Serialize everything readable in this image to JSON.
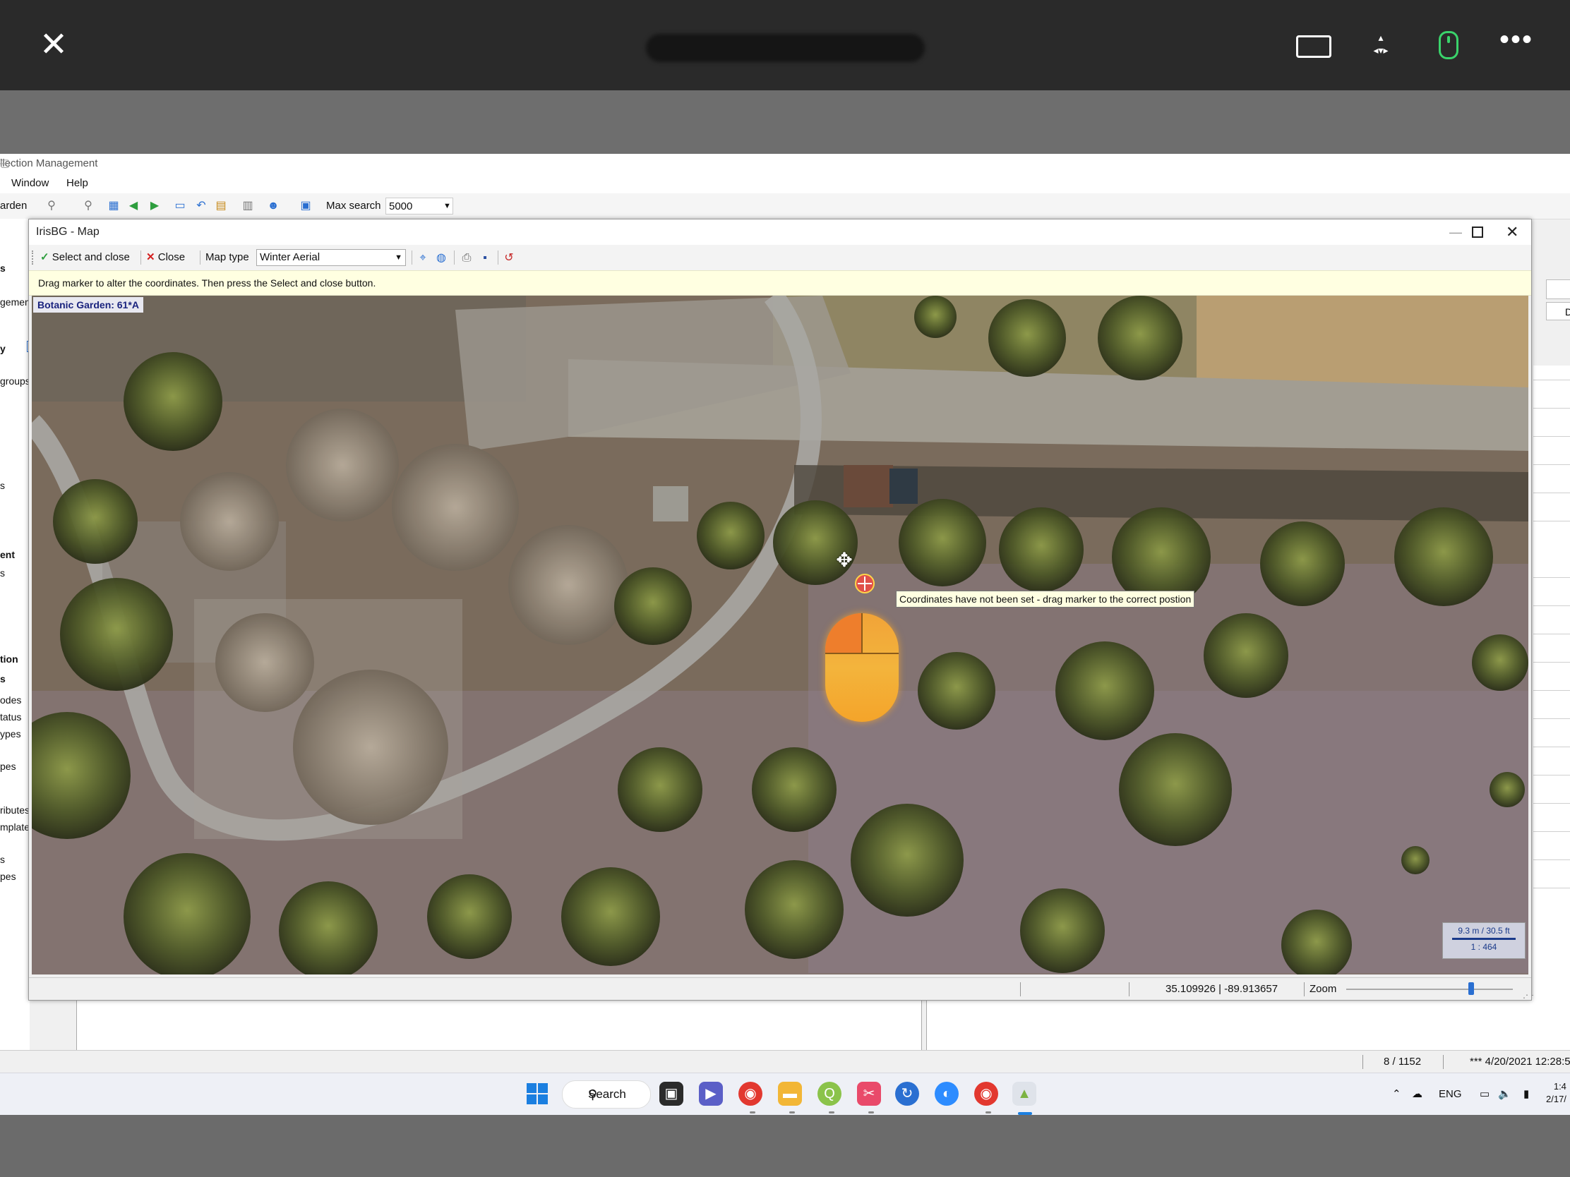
{
  "remote_bar": {
    "close_icon": "close-icon",
    "keyboard_icon": "keyboard-icon",
    "arrows_icon": "arrow-keys-icon",
    "mouse_icon": "mouse-icon",
    "more_glyph": "•••"
  },
  "app": {
    "title": "llection Management",
    "menu": [
      "Window",
      "Help"
    ],
    "toolbar_left_label": "arden",
    "max_search_label": "Max search",
    "max_search_value": "5000",
    "left_strip": [
      "s",
      "gemen",
      "y",
      "groups",
      "s",
      "ent",
      "s",
      "tion",
      "s",
      "odes",
      "tatus",
      "ypes",
      "pes",
      "ributes",
      "mplates",
      "s",
      "pes"
    ],
    "right_field_label": "D",
    "status": {
      "records": "8 / 1152",
      "stamp": "*** 4/20/2021 12:28:5"
    }
  },
  "map_dialog": {
    "title": "IrisBG - Map",
    "select_close_label": "Select and close",
    "close_label": "Close",
    "map_type_label": "Map type",
    "map_type_value": "Winter Aerial",
    "hint": "Drag marker to alter the coordinates. Then press the Select and close button.",
    "garden_label": "Botanic Garden: 61*A",
    "tooltip": "Coordinates have not been set - drag marker to the correct postion",
    "scale_metric": "9.3 m / 30.5 ft",
    "scale_ratio": "1 : 464",
    "coordinates": "35.109926 | -89.913657",
    "zoom_label": "Zoom",
    "zoom_level": 0.75
  },
  "taskbar": {
    "search_label": "Search",
    "tray_lang": "ENG",
    "clock_time": "1:4",
    "clock_date": "2/17/"
  },
  "colors": {
    "accent": "#1b7fe0",
    "hint_bg": "#ffffe1",
    "remote_bar": "#2a2a2a",
    "mouse_overlay": "#f3b43c",
    "mouse_indicator": "#3ad36b"
  }
}
